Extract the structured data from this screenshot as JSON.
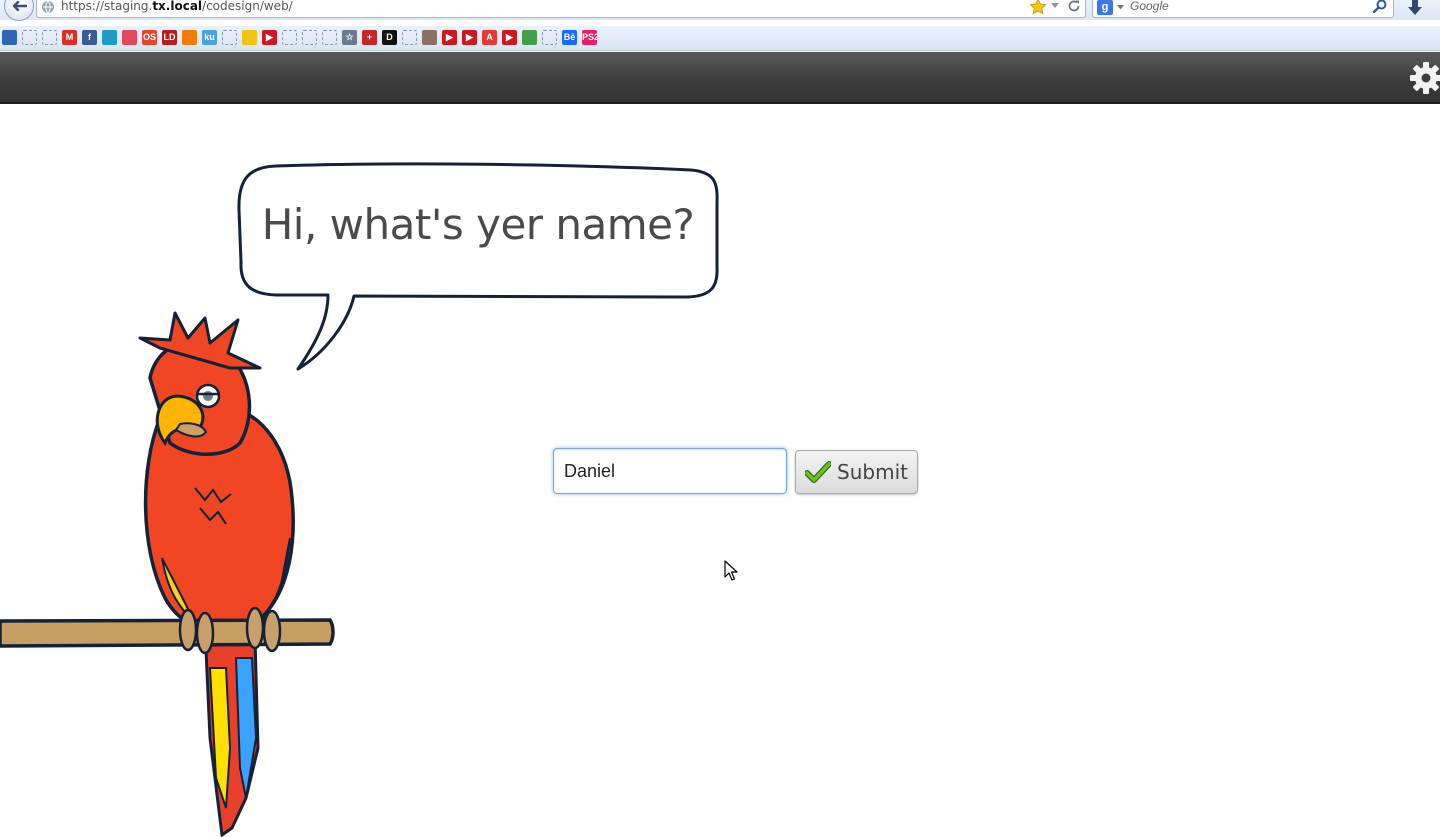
{
  "browser": {
    "url_prefix": "https://staging.",
    "url_host": "tx.local",
    "url_path": "/codesign/web/",
    "search_placeholder": "Google",
    "search_engine_letter": "g",
    "bookmarks": [
      {
        "icon": "search-icon",
        "label": "",
        "color": "#2f66b3"
      },
      {
        "icon": "blank-icon",
        "label": "",
        "color": ""
      },
      {
        "icon": "blank-icon",
        "label": "",
        "color": ""
      },
      {
        "icon": "gmail-icon",
        "label": "M",
        "color": "#d93025"
      },
      {
        "icon": "facebook-icon",
        "label": "f",
        "color": "#3b5998"
      },
      {
        "icon": "bookmark-icon",
        "label": "",
        "color": "#1e9ac7"
      },
      {
        "icon": "flower-icon",
        "label": "",
        "color": "#e5485c"
      },
      {
        "icon": "bookmark-icon",
        "label": "OS",
        "color": "#e8452c"
      },
      {
        "icon": "bookmark-icon",
        "label": "LD",
        "color": "#b71c1c"
      },
      {
        "icon": "bookmark-icon",
        "label": "",
        "color": "#f57c00"
      },
      {
        "icon": "bookmark-icon",
        "label": "ku",
        "color": "#4aa3df"
      },
      {
        "icon": "blank-icon",
        "label": "",
        "color": ""
      },
      {
        "icon": "bulb-icon",
        "label": "",
        "color": "#f1c40f"
      },
      {
        "icon": "youtube-icon",
        "label": "▶",
        "color": "#cc181e"
      },
      {
        "icon": "blank-icon",
        "label": "",
        "color": ""
      },
      {
        "icon": "blank-icon",
        "label": "",
        "color": ""
      },
      {
        "icon": "blank-icon",
        "label": "",
        "color": ""
      },
      {
        "icon": "star-outline-icon",
        "label": "☆",
        "color": "#6b7b8f"
      },
      {
        "icon": "plus-icon",
        "label": "+",
        "color": "#c62828"
      },
      {
        "icon": "bookmark-icon",
        "label": "D",
        "color": "#111111"
      },
      {
        "icon": "blank-icon",
        "label": "",
        "color": ""
      },
      {
        "icon": "bookmark-icon",
        "label": "",
        "color": "#8d6e63"
      },
      {
        "icon": "youtube-icon",
        "label": "▶",
        "color": "#cc181e"
      },
      {
        "icon": "youtube-icon",
        "label": "▶",
        "color": "#cc181e"
      },
      {
        "icon": "adobe-icon",
        "label": "A",
        "color": "#e53935"
      },
      {
        "icon": "youtube-icon",
        "label": "▶",
        "color": "#cc181e"
      },
      {
        "icon": "bookmark-icon",
        "label": "",
        "color": "#43a047"
      },
      {
        "icon": "blank-icon",
        "label": "",
        "color": ""
      },
      {
        "icon": "behance-icon",
        "label": "Bē",
        "color": "#1769ff"
      },
      {
        "icon": "ps2pdf-icon",
        "label": "PS2",
        "color": "#e91e63"
      }
    ]
  },
  "header": {
    "gear_icon": "gear-icon",
    "background": "#3c3c3c"
  },
  "main": {
    "speech_text": "Hi, what's yer name?",
    "name_input_value": "Daniel",
    "submit_label": "Submit",
    "submit_icon": "check-icon",
    "accent": "#5a9a1e"
  }
}
